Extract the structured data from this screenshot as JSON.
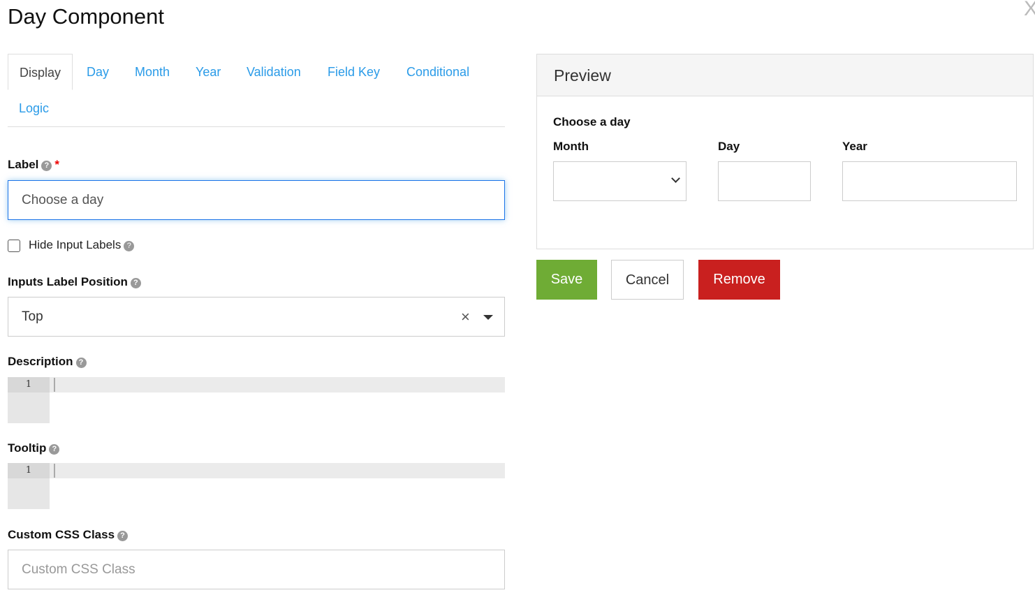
{
  "title": "Day Component",
  "close_label": "X",
  "tabs": [
    "Display",
    "Day",
    "Month",
    "Year",
    "Validation",
    "Field Key",
    "Conditional",
    "Logic"
  ],
  "form": {
    "label": {
      "label": "Label",
      "required": "*",
      "value": "Choose a day"
    },
    "hide_labels": {
      "label": "Hide Input Labels",
      "checked": false
    },
    "label_position": {
      "label": "Inputs Label Position",
      "value": "Top",
      "clear": "×"
    },
    "description": {
      "label": "Description",
      "line": "1"
    },
    "tooltip": {
      "label": "Tooltip",
      "line": "1"
    },
    "css": {
      "label": "Custom CSS Class",
      "placeholder": "Custom CSS Class"
    }
  },
  "preview": {
    "title": "Preview",
    "field_label": "Choose a day",
    "month": "Month",
    "day": "Day",
    "year": "Year"
  },
  "buttons": {
    "save": "Save",
    "cancel": "Cancel",
    "remove": "Remove"
  },
  "colors": {
    "save": "#6fac35",
    "remove": "#c9201f",
    "link": "#2a9be8"
  }
}
